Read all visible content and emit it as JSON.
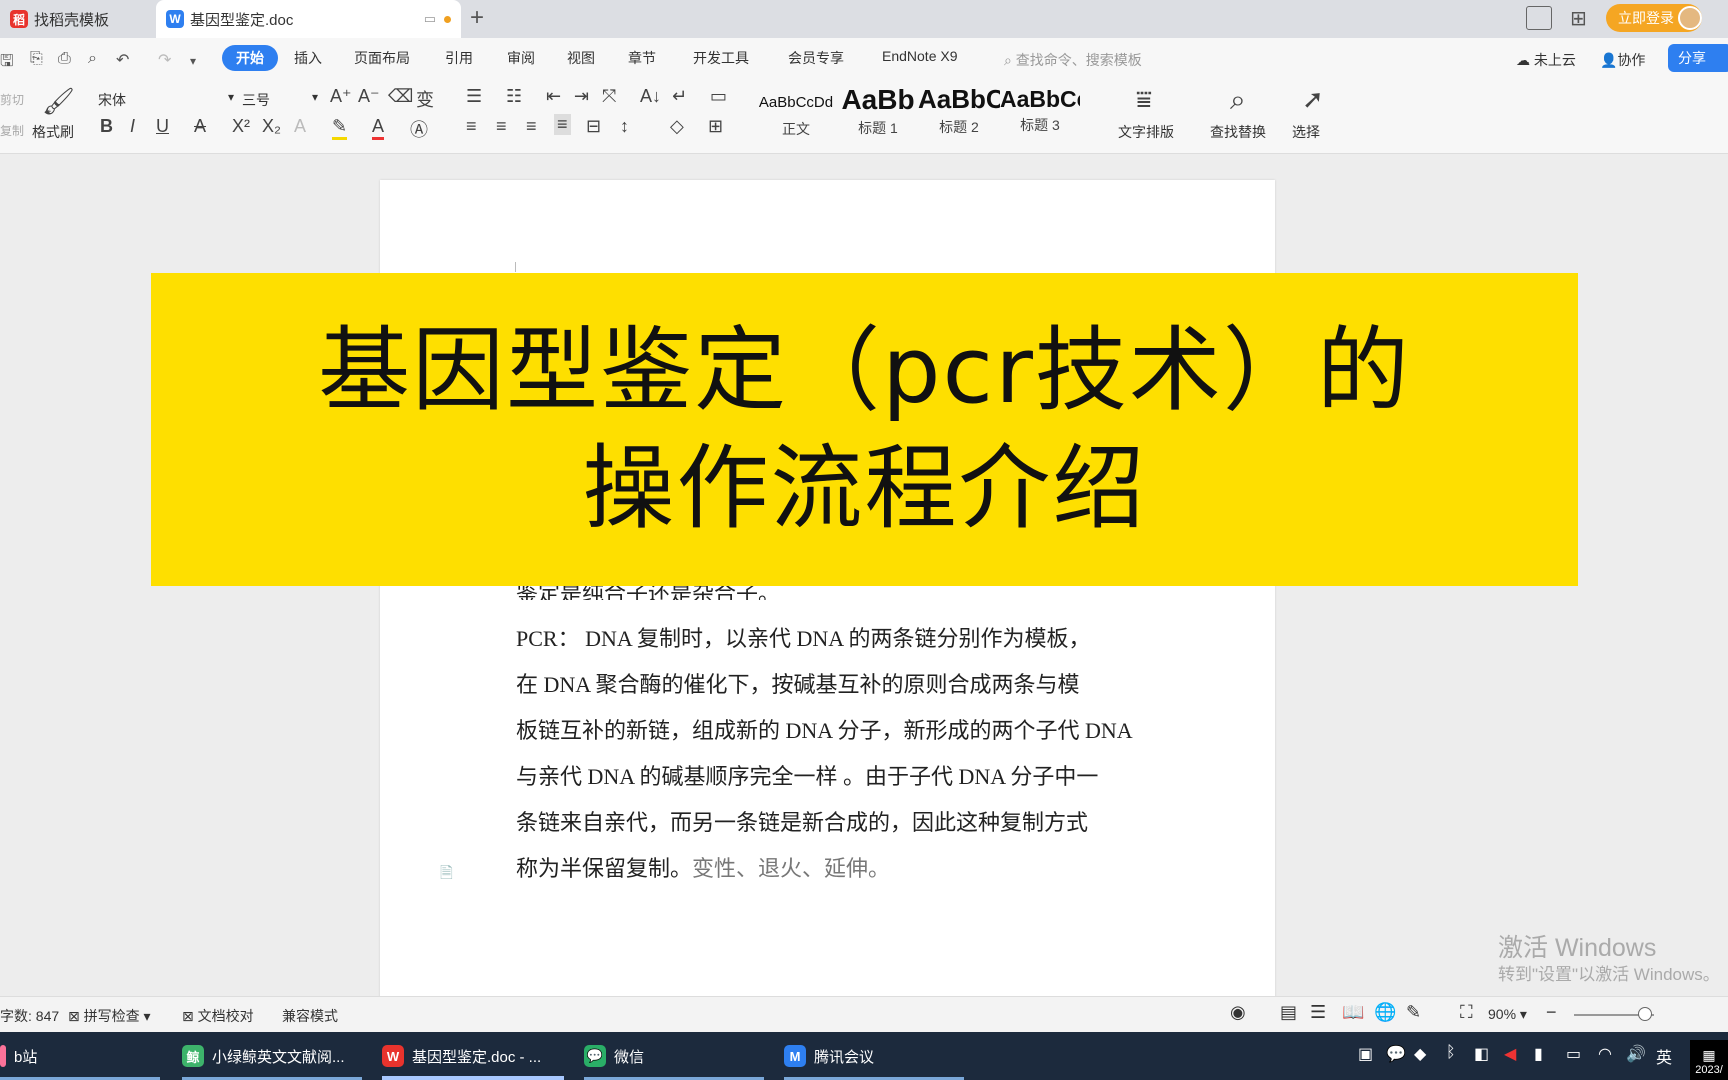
{
  "tabs": [
    {
      "label": "找稻壳模板",
      "icon": "docer-icon"
    },
    {
      "label": "基因型鉴定.doc",
      "icon": "word-doc-icon"
    }
  ],
  "window": {
    "login_label": "立即登录"
  },
  "ribbon": {
    "menus": [
      "开始",
      "插入",
      "页面布局",
      "引用",
      "审阅",
      "视图",
      "章节",
      "开发工具",
      "会员专享",
      "EndNote X9"
    ],
    "search_placeholder": "查找命令、搜索模板",
    "cloud_label": "未上云",
    "collab_label": "协作",
    "share_label": "分享",
    "cut_label": "剪切",
    "copy_label": "复制",
    "format_painter": "格式刷",
    "font_name": "宋体",
    "font_size": "三号",
    "styles": [
      {
        "preview": "AaBbCcDd",
        "label": "正文"
      },
      {
        "preview": "AaBb",
        "label": "标题 1"
      },
      {
        "preview": "AaBbC",
        "label": "标题 2"
      },
      {
        "preview": "AaBbCc",
        "label": "标题 3"
      }
    ],
    "text_layout": "文字排版",
    "find_replace": "查找替换",
    "select": "选择"
  },
  "document": {
    "partial_line": "鉴定是纯合子还是杂合子。",
    "lines": [
      "PCR： DNA 复制时，以亲代 DNA 的两条链分别作为模板，",
      "在 DNA 聚合酶的催化下，按碱基互补的原则合成两条与模",
      "板链互补的新链，组成新的 DNA 分子，新形成的两个子代 DNA",
      "与亲代 DNA 的碱基顺序完全一样 。由于子代 DNA 分子中一",
      "条链来自亲代，而另一条链是新合成的，因此这种复制方式",
      "称为半保留复制。"
    ],
    "trailing_text": "变性、退火、延伸。"
  },
  "banner": {
    "line1": "基因型鉴定（pcr技术）的",
    "line2": "操作流程介绍"
  },
  "watermark": {
    "line1": "激活 Windows",
    "line2": "转到\"设置\"以激活 Windows。"
  },
  "status": {
    "word_count": "字数: 847",
    "spell_check": "拼写检查",
    "doc_proof": "文档校对",
    "compat_mode": "兼容模式",
    "zoom": "90%"
  },
  "taskbar": {
    "apps": [
      {
        "label": "b站"
      },
      {
        "label": "小绿鲸英文文献阅..."
      },
      {
        "label": "基因型鉴定.doc - ..."
      },
      {
        "label": "微信"
      },
      {
        "label": "腾讯会议"
      }
    ],
    "ime": "英",
    "date": "2023/"
  },
  "colors": {
    "accent": "#2e7ff0",
    "banner": "#fedf00",
    "taskbar": "#1c2a3d",
    "login": "#f5a623"
  }
}
